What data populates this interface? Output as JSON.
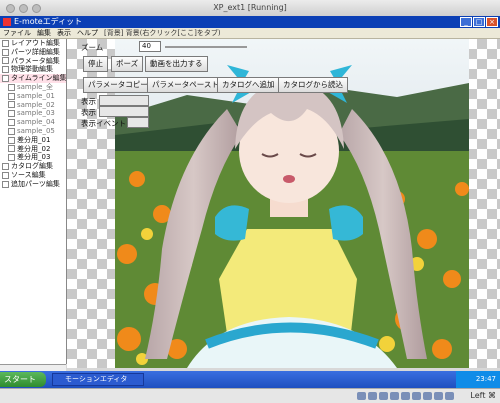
{
  "host": {
    "title": "XP_ext1 [Running]",
    "host_key": "Left ⌘"
  },
  "app": {
    "title": "E-moteエディット",
    "menu": [
      "ファイル",
      "編集",
      "表示",
      "ヘルプ"
    ],
    "menu_hint": "[背景] 背景(右クリック[ここ]をタブ)"
  },
  "tree": {
    "items": [
      {
        "label": "レイアウト編集",
        "dim": false
      },
      {
        "label": "パーツ詳細編集",
        "dim": false
      },
      {
        "label": "パラメータ編集",
        "dim": false
      },
      {
        "label": "物理挙動編集",
        "dim": false
      },
      {
        "label": "タイムライン編集",
        "dim": false
      },
      {
        "label": "sample_全",
        "dim": true
      },
      {
        "label": "sample_01",
        "dim": true
      },
      {
        "label": "sample_02",
        "dim": true
      },
      {
        "label": "sample_03",
        "dim": true
      },
      {
        "label": "sample_04",
        "dim": true
      },
      {
        "label": "sample_05",
        "dim": true
      },
      {
        "label": "差分用_01",
        "dim": false
      },
      {
        "label": "差分用_02",
        "dim": false
      },
      {
        "label": "差分用_03",
        "dim": false
      },
      {
        "label": "カタログ編集",
        "dim": false
      },
      {
        "label": "ソース編集",
        "dim": false
      },
      {
        "label": "追加パーツ編集",
        "dim": false
      }
    ]
  },
  "toolbar": {
    "zoom_label": "ズーム",
    "zoom_value": "40",
    "stop": "停止",
    "pause": "ポーズ",
    "export_movie": "動画を出力する",
    "param_copy": "パラメータコピー",
    "param_paste": "パラメータペースト",
    "catalog_add": "カタログへ追加",
    "catalog_load": "カタログから読込",
    "field1_label": "表示",
    "field2_label": "表示",
    "field3_label": "表示イベント"
  },
  "taskbar": {
    "start": "スタート",
    "task_item": "モーションエディタ",
    "clock": "23:47"
  },
  "colors": {
    "title_bar": "#0b3fb5",
    "taskbar": "#1e4fc0",
    "start": "#2e8b2e"
  }
}
